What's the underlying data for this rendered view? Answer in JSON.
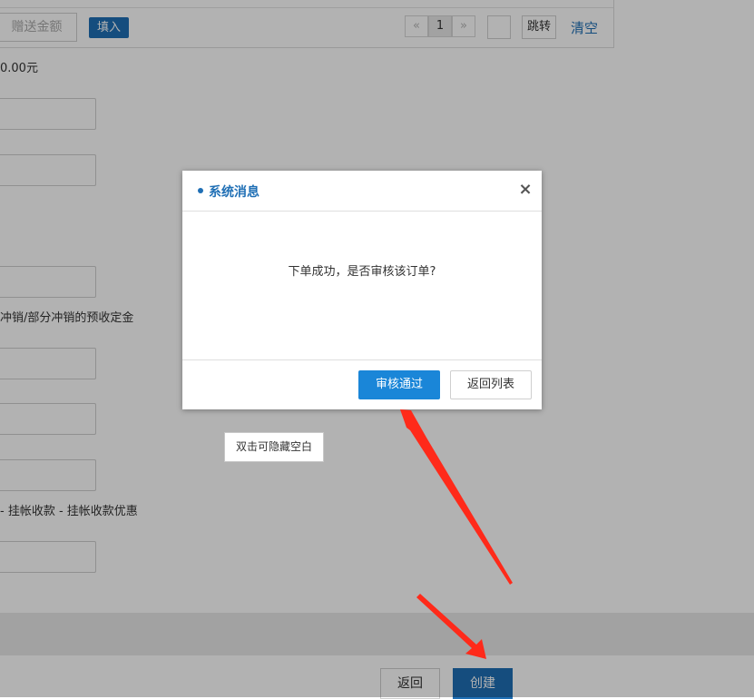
{
  "toolbar": {
    "gift_amount_placeholder": "赠送金额",
    "fill_button": "填入",
    "pager": {
      "prev": "«",
      "current": "1",
      "next": "»"
    },
    "jump_button": "跳转",
    "clear_link": "清空"
  },
  "form": {
    "amount_text": "0.00元",
    "deposit_hint": "冲销/部分冲销的预收定金",
    "formula_hint": "- 挂帐收款 - 挂帐收款优惠"
  },
  "footer": {
    "back_button": "返回",
    "create_button": "创建"
  },
  "dialog": {
    "title": "系统消息",
    "close_icon": "×",
    "message": "下单成功，是否审核该订单?",
    "approve_button": "审核通过",
    "return_list_button": "返回列表"
  },
  "tooltip": {
    "text": "双击可隐藏空白"
  },
  "colors": {
    "brand_blue": "#1f6fb5",
    "approve_blue": "#1a86d8",
    "annotation_red": "#ff2a1a"
  }
}
